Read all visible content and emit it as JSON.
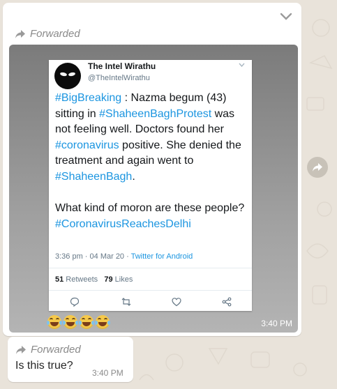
{
  "message1": {
    "forwarded_label": "Forwarded",
    "time": "3:40 PM",
    "tweet": {
      "display_name": "The Intel Wirathu",
      "handle": "@TheIntelWirathu",
      "body": {
        "hashtag1": "#BigBreaking",
        "text1": " : Nazma begum (43) sitting in ",
        "hashtag2": "#ShaheenBaghProtest",
        "text2": " was not feeling well. Doctors found her ",
        "hashtag3": "#coronavirus",
        "text3": " positive. She denied the treatment and again went to ",
        "hashtag4": "#ShaheenBagh",
        "text4": ".",
        "text5": "What kind of moron are these people?",
        "hashtag5": "#CoronavirusReachesDelhi"
      },
      "timestamp": "3:36 pm · 04 Mar 20 · ",
      "source": "Twitter for Android",
      "retweets_count": "51",
      "retweets_label": " Retweets",
      "likes_count": "79",
      "likes_label": " Likes",
      "action_icons": [
        "reply-icon",
        "retweet-icon",
        "like-icon",
        "share-icon"
      ]
    },
    "reaction_emojis": [
      "laughing-crying-emoji",
      "laughing-crying-emoji",
      "laughing-crying-emoji",
      "laughing-crying-emoji"
    ]
  },
  "message2": {
    "forwarded_label": "Forwarded",
    "text": "Is this true?",
    "time": "3:40 PM"
  },
  "colors": {
    "chat_background": "#e9e3da",
    "bubble": "#ffffff",
    "hashtag": "#1b95e0",
    "meta_text": "#8a8a8a"
  }
}
